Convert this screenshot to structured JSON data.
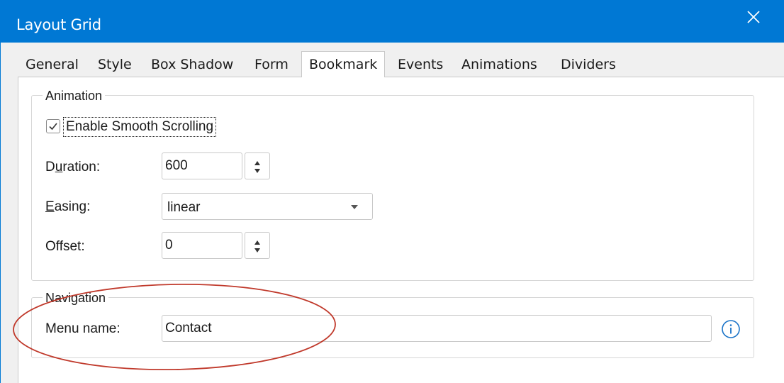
{
  "window": {
    "title": "Layout Grid"
  },
  "tabs": [
    {
      "label": "General"
    },
    {
      "label": "Style"
    },
    {
      "label": "Box Shadow"
    },
    {
      "label": "Form"
    },
    {
      "label": "Bookmark",
      "active": true
    },
    {
      "label": "Events"
    },
    {
      "label": "Animations"
    },
    {
      "label": "Dividers"
    }
  ],
  "animation": {
    "legend": "Animation",
    "smooth_scrolling": {
      "label": "Enable Smooth Scrolling",
      "checked": true
    },
    "duration": {
      "label_pre": "D",
      "label_ul": "u",
      "label_post": "ration:",
      "value": "600"
    },
    "easing": {
      "label_ul": "E",
      "label_post": "asing:",
      "value": "linear"
    },
    "offset": {
      "label": "Offset:",
      "value": "0"
    }
  },
  "navigation": {
    "legend": "Navigation",
    "menu_name": {
      "label": "Menu name:",
      "value": "Contact"
    }
  },
  "colors": {
    "titlebar": "#0078d4",
    "annotation": "#c0392b",
    "info": "#1a73c8"
  },
  "icons": {
    "close": "close-icon",
    "check": "check-icon",
    "info": "info-icon"
  }
}
